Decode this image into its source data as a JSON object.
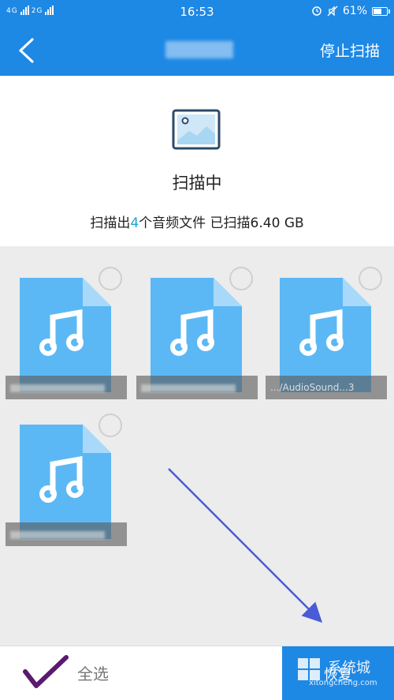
{
  "status_bar": {
    "network_1": "4G",
    "network_2": "2G",
    "time": "16:53",
    "battery": "61%",
    "icons": [
      "signal-icon",
      "alarm-icon",
      "mute-icon",
      "battery-icon"
    ]
  },
  "app_bar": {
    "back_icon": "chevron-left-icon",
    "stop_label": "停止扫描"
  },
  "scan": {
    "icon": "image-icon",
    "status": "扫描中",
    "summary_prefix": "扫描出",
    "summary_count": "4",
    "summary_suffix": "个音频文件 已扫描6.40 GB"
  },
  "files": [
    {
      "icon": "music-file-icon",
      "name_visible": ""
    },
    {
      "icon": "music-file-icon",
      "name_visible": ""
    },
    {
      "icon": "music-file-icon",
      "name_visible": ".../AudioSound...3"
    },
    {
      "icon": "music-file-icon",
      "name_visible": ""
    }
  ],
  "bottom_bar": {
    "select_all_label": "全选",
    "restore_label": "恢复"
  },
  "watermark": {
    "text": "xitongcheng.com"
  },
  "colors": {
    "brand_blue": "#1e88e5",
    "file_blue": "#5cb8f5",
    "highlight": "#1aa5d6",
    "annotation_arrow": "#4a5bd6",
    "check_mark": "#5a1a6e"
  }
}
